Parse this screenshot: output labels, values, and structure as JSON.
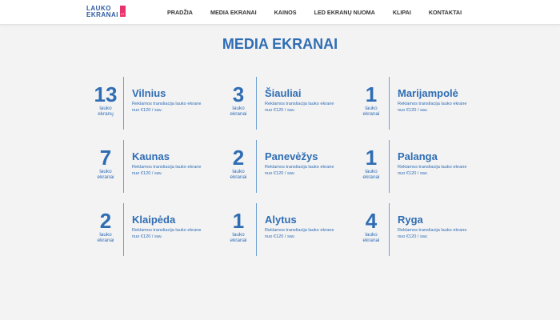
{
  "logo": {
    "line1": "LAUKO",
    "line2": "EKRANAI",
    "mark": "LT"
  },
  "nav": [
    "PRADŽIA",
    "MEDIA EKRANAI",
    "KAINOS",
    "LED EKRANŲ NUOMA",
    "KLIPAI",
    "KONTAKTAI"
  ],
  "page_title": "MEDIA EKRANAI",
  "cities": [
    {
      "count": "13",
      "unit": "lauko ekranų",
      "name": "Vilnius",
      "desc1": "Reklamos transliacija lauko ekrane",
      "desc2": "nuo €120 / sav."
    },
    {
      "count": "3",
      "unit": "lauko ekranai",
      "name": "Šiauliai",
      "desc1": "Reklamos transliacija lauko ekrane",
      "desc2": "nuo €120 / sav."
    },
    {
      "count": "1",
      "unit": "lauko ekranai",
      "name": "Marijampolė",
      "desc1": "Reklamos transliacija lauko ekrane",
      "desc2": "nuo €120 / sav."
    },
    {
      "count": "7",
      "unit": "lauko ekranai",
      "name": "Kaunas",
      "desc1": "Reklamos transliacija lauko ekrane",
      "desc2": "nuo €120 / sav."
    },
    {
      "count": "2",
      "unit": "lauko ekranai",
      "name": "Panevėžys",
      "desc1": "Reklamos transliacija lauko ekrane",
      "desc2": "nuo €120 / sav."
    },
    {
      "count": "1",
      "unit": "lauko ekranai",
      "name": "Palanga",
      "desc1": "Reklamos transliacija lauko ekrane",
      "desc2": "nuo €120 / sav."
    },
    {
      "count": "2",
      "unit": "lauko ekranai",
      "name": "Klaipėda",
      "desc1": "Reklamos transliacija lauko ekrane",
      "desc2": "nuo €120 / sav."
    },
    {
      "count": "1",
      "unit": "lauko ekranai",
      "name": "Alytus",
      "desc1": "Reklamos transliacija lauko ekrane",
      "desc2": "nuo €120 / sav."
    },
    {
      "count": "4",
      "unit": "lauko ekranai",
      "name": "Ryga",
      "desc1": "Reklamos transliacija lauko ekrane",
      "desc2": "nuo €120 / sav."
    }
  ],
  "colors": {
    "accent": "#2f6db3",
    "logo_pink": "#e8336d",
    "background": "#f3f3f4"
  }
}
